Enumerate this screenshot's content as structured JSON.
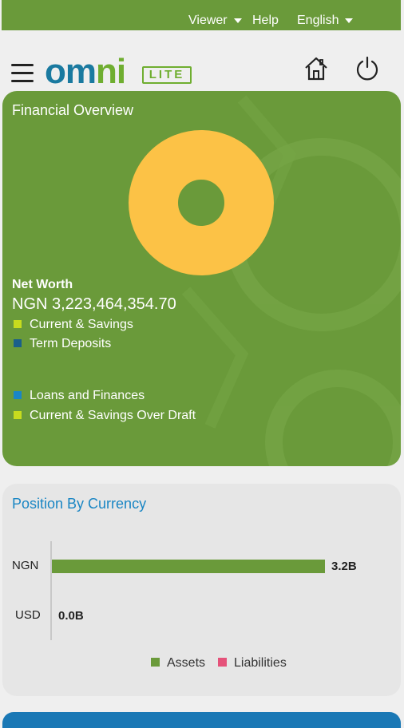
{
  "topbar": {
    "role_label": "Viewer",
    "help_label": "Help",
    "language_label": "English"
  },
  "logo": {
    "part1": "om",
    "part2": "ni",
    "badge": "LITE"
  },
  "overview": {
    "title": "Financial Overview",
    "net_worth_label": "Net Worth",
    "net_worth_value": "NGN 3,223,464,354.70",
    "legend": [
      {
        "label": "Current & Savings",
        "color": "#c7dc1e"
      },
      {
        "label": "Term Deposits",
        "color": "#1a5f8a"
      },
      {
        "label": "Loans and Finances",
        "color": "#1a86c4"
      },
      {
        "label": "Current & Savings Over Draft",
        "color": "#c7dc1e"
      }
    ],
    "donut_color": "#fcc246"
  },
  "position": {
    "title": "Position By Currency",
    "rows": [
      {
        "currency": "NGN",
        "value_label": "3.2B",
        "fraction": 1.0
      },
      {
        "currency": "USD",
        "value_label": "0.0B",
        "fraction": 0.0
      }
    ],
    "legend": [
      {
        "label": "Assets",
        "color": "#6a9a3a"
      },
      {
        "label": "Liabilities",
        "color": "#e5527a"
      }
    ]
  },
  "chart_data": {
    "type": "bar",
    "title": "Position By Currency",
    "categories": [
      "NGN",
      "USD"
    ],
    "series": [
      {
        "name": "Assets",
        "values": [
          3.2,
          0.0
        ]
      },
      {
        "name": "Liabilities",
        "values": [
          0,
          0
        ]
      }
    ],
    "xlabel": "",
    "ylabel": ""
  }
}
